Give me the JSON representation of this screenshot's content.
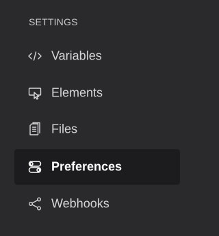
{
  "settings": {
    "section_title": "SETTINGS",
    "items": [
      {
        "label": "Variables",
        "icon": "code-icon",
        "active": false
      },
      {
        "label": "Elements",
        "icon": "element-cursor-icon",
        "active": false
      },
      {
        "label": "Files",
        "icon": "file-icon",
        "active": false
      },
      {
        "label": "Preferences",
        "icon": "toggles-icon",
        "active": true
      },
      {
        "label": "Webhooks",
        "icon": "share-icon",
        "active": false
      }
    ]
  },
  "colors": {
    "background": "#2a2a2d",
    "active_background": "#1c1c1e",
    "text": "#d6d6d9",
    "active_text": "#ffffff",
    "section_text": "#c9c9cc"
  }
}
